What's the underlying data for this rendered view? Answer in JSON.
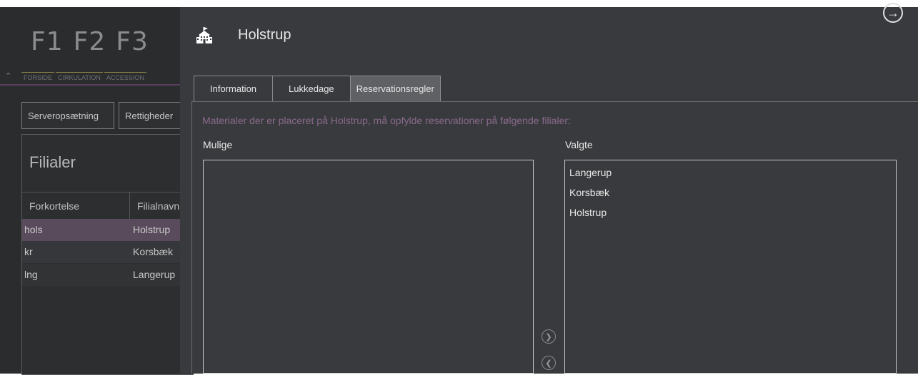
{
  "background_app": {
    "function_keys": [
      {
        "key": "F1",
        "label": "FORSIDE"
      },
      {
        "key": "F2",
        "label": "CIRKULATION"
      },
      {
        "key": "F3",
        "label": "ACCESSION"
      }
    ],
    "admin_tabs": [
      "Serveropsætning",
      "Rettigheder"
    ],
    "panel_title": "Filialer",
    "table": {
      "headers": [
        "Forkortelse",
        "Filialnavn"
      ],
      "rows": [
        {
          "abbr": "hols",
          "name": "Holstrup"
        },
        {
          "abbr": "kr",
          "name": "Korsbæk"
        },
        {
          "abbr": "lng",
          "name": "Langerup"
        }
      ]
    }
  },
  "dialog": {
    "title": "Holstrup",
    "tabs": [
      "Information",
      "Lukkedage",
      "Reservationsregler"
    ],
    "active_tab": "Reservationsregler",
    "info_text": "Materialer der er placeret på Holstrup, må opfylde reservationer på følgende filialer:",
    "available_label": "Mulige",
    "selected_label": "Valgte",
    "available_items": [],
    "selected_items": [
      "Langerup",
      "Korsbæk",
      "Holstrup"
    ]
  },
  "icons": {
    "exit": "exit-arrow-icon",
    "title": "school-building-icon",
    "move_right": "chevron-right-circle-icon",
    "move_left": "chevron-left-circle-icon",
    "collapse": "chevron-up-icon"
  },
  "colors": {
    "dialog_bg": "#383a3d",
    "accent_purple": "#8a6a8c",
    "selected_row": "#5a4b5c"
  }
}
